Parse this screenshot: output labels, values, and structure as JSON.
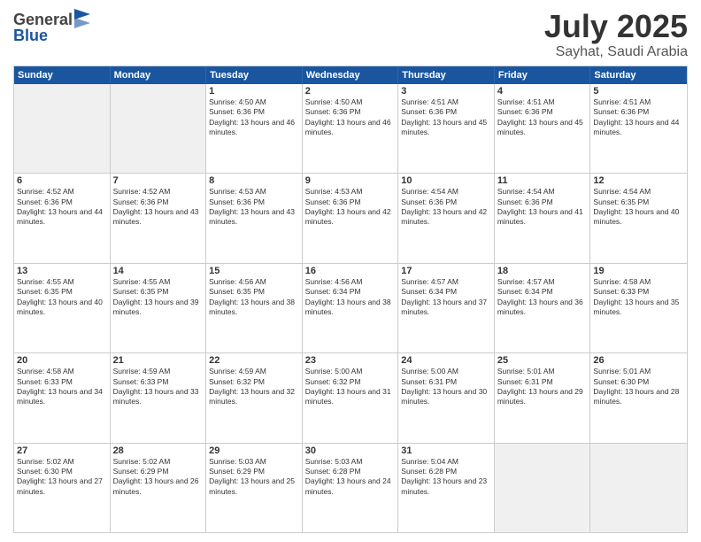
{
  "header": {
    "logo_line1": "General",
    "logo_line2": "Blue",
    "month": "July 2025",
    "location": "Sayhat, Saudi Arabia"
  },
  "weekdays": [
    "Sunday",
    "Monday",
    "Tuesday",
    "Wednesday",
    "Thursday",
    "Friday",
    "Saturday"
  ],
  "rows": [
    [
      {
        "day": "",
        "info": "",
        "shaded": true
      },
      {
        "day": "",
        "info": "",
        "shaded": true
      },
      {
        "day": "1",
        "info": "Sunrise: 4:50 AM\nSunset: 6:36 PM\nDaylight: 13 hours and 46 minutes."
      },
      {
        "day": "2",
        "info": "Sunrise: 4:50 AM\nSunset: 6:36 PM\nDaylight: 13 hours and 46 minutes."
      },
      {
        "day": "3",
        "info": "Sunrise: 4:51 AM\nSunset: 6:36 PM\nDaylight: 13 hours and 45 minutes."
      },
      {
        "day": "4",
        "info": "Sunrise: 4:51 AM\nSunset: 6:36 PM\nDaylight: 13 hours and 45 minutes."
      },
      {
        "day": "5",
        "info": "Sunrise: 4:51 AM\nSunset: 6:36 PM\nDaylight: 13 hours and 44 minutes."
      }
    ],
    [
      {
        "day": "6",
        "info": "Sunrise: 4:52 AM\nSunset: 6:36 PM\nDaylight: 13 hours and 44 minutes."
      },
      {
        "day": "7",
        "info": "Sunrise: 4:52 AM\nSunset: 6:36 PM\nDaylight: 13 hours and 43 minutes."
      },
      {
        "day": "8",
        "info": "Sunrise: 4:53 AM\nSunset: 6:36 PM\nDaylight: 13 hours and 43 minutes."
      },
      {
        "day": "9",
        "info": "Sunrise: 4:53 AM\nSunset: 6:36 PM\nDaylight: 13 hours and 42 minutes."
      },
      {
        "day": "10",
        "info": "Sunrise: 4:54 AM\nSunset: 6:36 PM\nDaylight: 13 hours and 42 minutes."
      },
      {
        "day": "11",
        "info": "Sunrise: 4:54 AM\nSunset: 6:36 PM\nDaylight: 13 hours and 41 minutes."
      },
      {
        "day": "12",
        "info": "Sunrise: 4:54 AM\nSunset: 6:35 PM\nDaylight: 13 hours and 40 minutes."
      }
    ],
    [
      {
        "day": "13",
        "info": "Sunrise: 4:55 AM\nSunset: 6:35 PM\nDaylight: 13 hours and 40 minutes."
      },
      {
        "day": "14",
        "info": "Sunrise: 4:55 AM\nSunset: 6:35 PM\nDaylight: 13 hours and 39 minutes."
      },
      {
        "day": "15",
        "info": "Sunrise: 4:56 AM\nSunset: 6:35 PM\nDaylight: 13 hours and 38 minutes."
      },
      {
        "day": "16",
        "info": "Sunrise: 4:56 AM\nSunset: 6:34 PM\nDaylight: 13 hours and 38 minutes."
      },
      {
        "day": "17",
        "info": "Sunrise: 4:57 AM\nSunset: 6:34 PM\nDaylight: 13 hours and 37 minutes."
      },
      {
        "day": "18",
        "info": "Sunrise: 4:57 AM\nSunset: 6:34 PM\nDaylight: 13 hours and 36 minutes."
      },
      {
        "day": "19",
        "info": "Sunrise: 4:58 AM\nSunset: 6:33 PM\nDaylight: 13 hours and 35 minutes."
      }
    ],
    [
      {
        "day": "20",
        "info": "Sunrise: 4:58 AM\nSunset: 6:33 PM\nDaylight: 13 hours and 34 minutes."
      },
      {
        "day": "21",
        "info": "Sunrise: 4:59 AM\nSunset: 6:33 PM\nDaylight: 13 hours and 33 minutes."
      },
      {
        "day": "22",
        "info": "Sunrise: 4:59 AM\nSunset: 6:32 PM\nDaylight: 13 hours and 32 minutes."
      },
      {
        "day": "23",
        "info": "Sunrise: 5:00 AM\nSunset: 6:32 PM\nDaylight: 13 hours and 31 minutes."
      },
      {
        "day": "24",
        "info": "Sunrise: 5:00 AM\nSunset: 6:31 PM\nDaylight: 13 hours and 30 minutes."
      },
      {
        "day": "25",
        "info": "Sunrise: 5:01 AM\nSunset: 6:31 PM\nDaylight: 13 hours and 29 minutes."
      },
      {
        "day": "26",
        "info": "Sunrise: 5:01 AM\nSunset: 6:30 PM\nDaylight: 13 hours and 28 minutes."
      }
    ],
    [
      {
        "day": "27",
        "info": "Sunrise: 5:02 AM\nSunset: 6:30 PM\nDaylight: 13 hours and 27 minutes."
      },
      {
        "day": "28",
        "info": "Sunrise: 5:02 AM\nSunset: 6:29 PM\nDaylight: 13 hours and 26 minutes."
      },
      {
        "day": "29",
        "info": "Sunrise: 5:03 AM\nSunset: 6:29 PM\nDaylight: 13 hours and 25 minutes."
      },
      {
        "day": "30",
        "info": "Sunrise: 5:03 AM\nSunset: 6:28 PM\nDaylight: 13 hours and 24 minutes."
      },
      {
        "day": "31",
        "info": "Sunrise: 5:04 AM\nSunset: 6:28 PM\nDaylight: 13 hours and 23 minutes."
      },
      {
        "day": "",
        "info": "",
        "shaded": true
      },
      {
        "day": "",
        "info": "",
        "shaded": true
      }
    ]
  ]
}
